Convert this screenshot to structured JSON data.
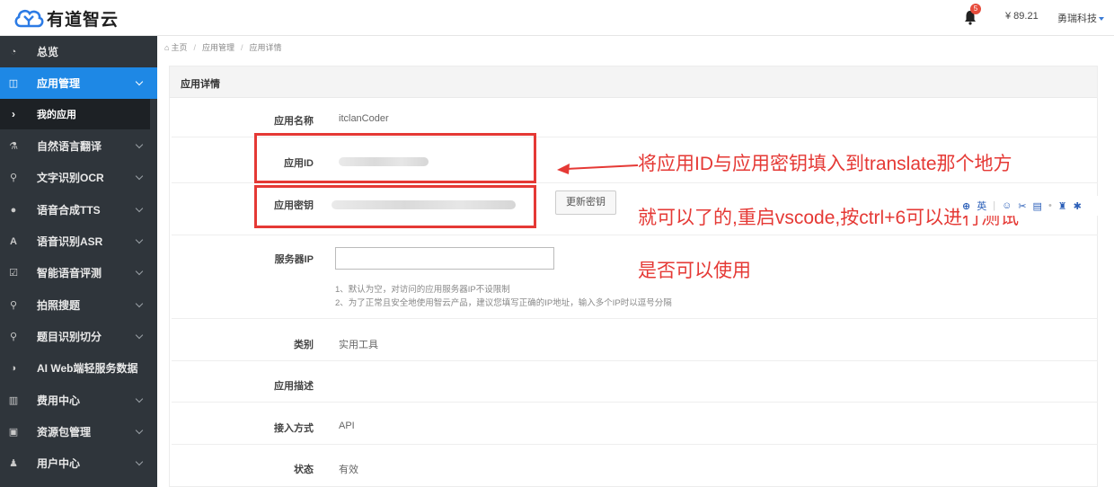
{
  "header": {
    "logo_text": "有道智云",
    "notification_count": "5",
    "balance": "¥ 89.21",
    "company": "勇瑞科技"
  },
  "sidebar": {
    "items": [
      {
        "icon": "dashboard-icon",
        "label": "总览"
      },
      {
        "icon": "app-icon",
        "label": "应用管理"
      },
      {
        "icon": "flask-icon",
        "label": "自然语言翻译"
      },
      {
        "icon": "search-icon",
        "label": "文字识别OCR"
      },
      {
        "icon": "microphone-icon",
        "label": "语音合成TTS"
      },
      {
        "icon": "font-icon",
        "label": "语音识别ASR"
      },
      {
        "icon": "checkbox-icon",
        "label": "智能语音评测"
      },
      {
        "icon": "search-icon",
        "label": "拍照搜题"
      },
      {
        "icon": "search-icon",
        "label": "题目识别切分"
      },
      {
        "icon": "half-circle-icon",
        "label": "AI Web端轻服务数据"
      },
      {
        "icon": "bar-chart-icon",
        "label": "费用中心"
      },
      {
        "icon": "package-icon",
        "label": "资源包管理"
      },
      {
        "icon": "user-icon",
        "label": "用户中心"
      }
    ],
    "sub_item": "我的应用"
  },
  "breadcrumb": [
    "主页",
    "应用管理",
    "应用详情"
  ],
  "panel": {
    "title": "应用详情",
    "fields": {
      "app_name_label": "应用名称",
      "app_name_value": "itclanCoder",
      "app_id_label": "应用ID",
      "app_key_label": "应用密钥",
      "renew_button": "更新密钥",
      "server_ip_label": "服务器IP",
      "ip_hint_1": "1、默认为空，对访问的应用服务器IP不设限制",
      "ip_hint_2": "2、为了正常且安全地使用智云产品，建议您填写正确的IP地址，输入多个IP时以逗号分隔",
      "category_label": "类别",
      "category_value": "实用工具",
      "desc_label": "应用描述",
      "access_label": "接入方式",
      "access_value": "API",
      "status_label": "状态",
      "status_value": "有效"
    }
  },
  "annotation": {
    "line1": "将应用ID与应用密钥填入到translate那个地方",
    "line2": "就可以了的,重启vscode,按ctrl+6可以进行测试",
    "line3": "是否可以使用"
  },
  "floating_toolbar": {
    "lang": "英"
  },
  "colors": {
    "sidebar_bg": "#2f353b",
    "active_blue": "#1e88e5",
    "annotation_red": "#e53935"
  }
}
